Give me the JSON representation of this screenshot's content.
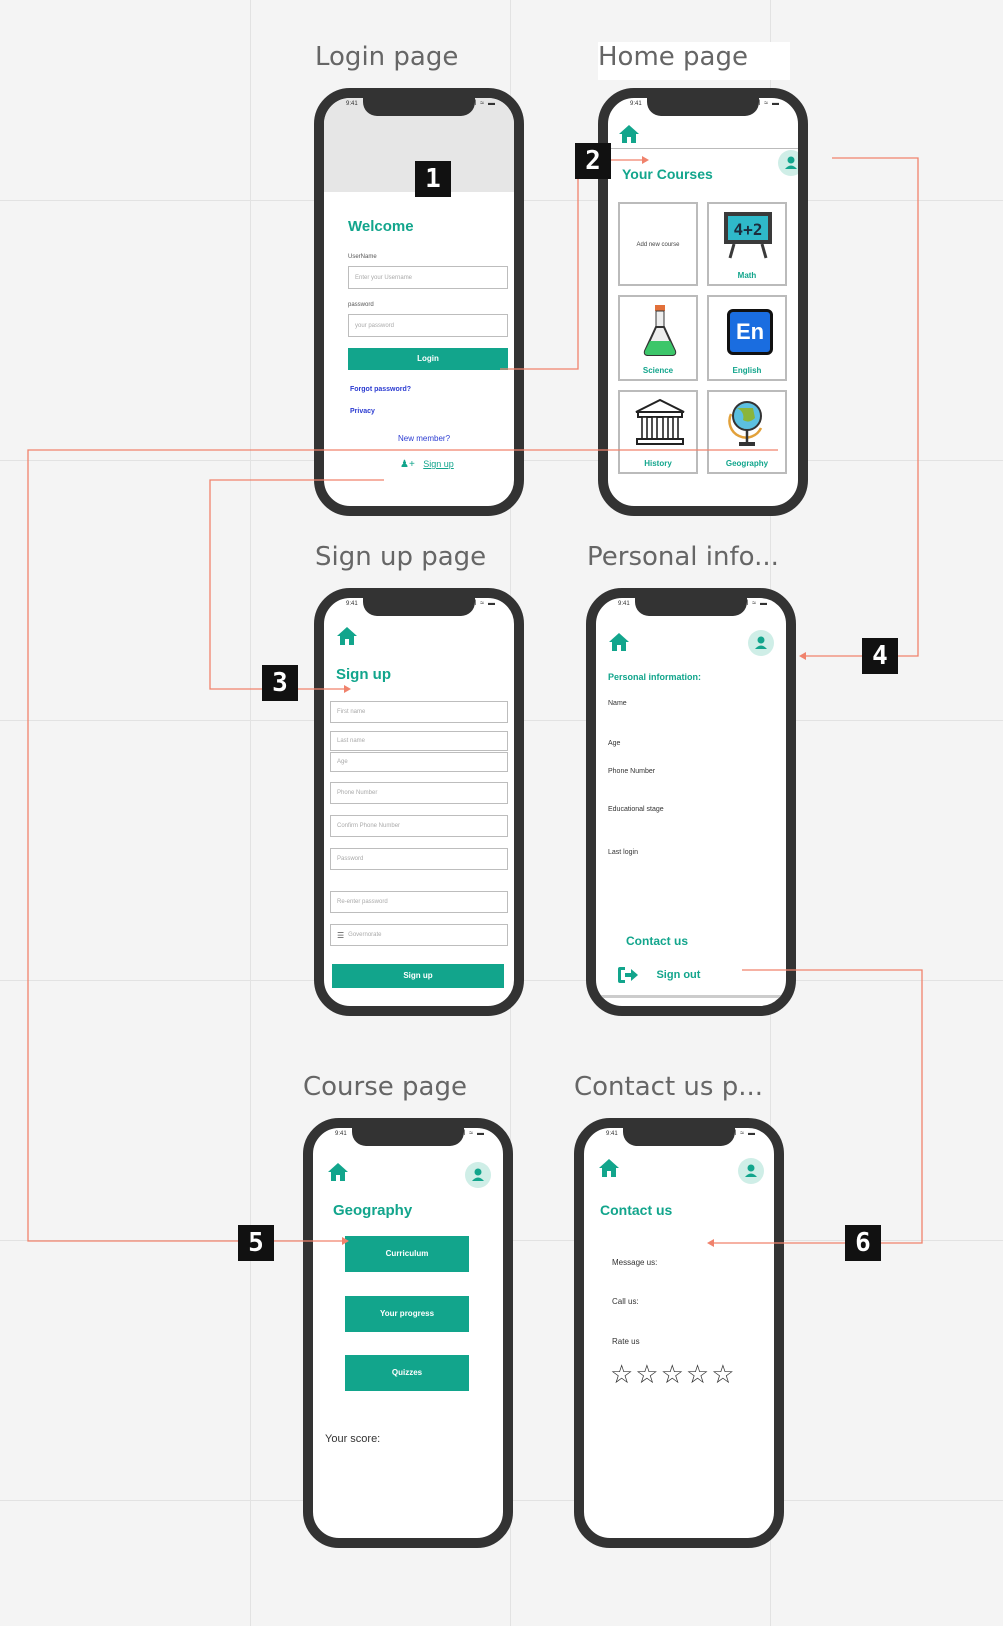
{
  "frames": {
    "login": "Login page",
    "home": "Home page",
    "signup": "Sign up page",
    "personal": "Personal info...",
    "course": "Course page",
    "contact": "Contact us p..."
  },
  "status_bar": {
    "time": "9:41",
    "icons": "ıl ≈ ▬"
  },
  "badges": [
    "1",
    "2",
    "3",
    "4",
    "5",
    "6"
  ],
  "login": {
    "welcome": "Welcome",
    "username_label": "UserName",
    "username_placeholder": "Enter your Username",
    "password_label": "password",
    "password_placeholder": "your password",
    "login_button": "Login",
    "forgot": "Forgot password?",
    "privacy": "Privacy",
    "new_member": "New member?",
    "signup_link": "Sign up"
  },
  "home": {
    "title": "Your Courses",
    "add_courses": "Add new course",
    "courses": [
      "Math",
      "Science",
      "English",
      "History",
      "Geography"
    ],
    "math_board": "4+2",
    "english_badge": "En"
  },
  "signup": {
    "title": "Sign up",
    "fields": [
      "First name",
      "Last name",
      "Age",
      "Phone Number",
      "Confirm Phone Number",
      "Password",
      "Re-enter password",
      "Governorate"
    ],
    "button": "Sign up"
  },
  "personal": {
    "title": "Personal information:",
    "fields": [
      "Name",
      "Age",
      "Phone Number",
      "Educational stage",
      "Last login"
    ],
    "contact_us": "Contact us",
    "sign_out": "Sign out"
  },
  "course": {
    "title": "Geography",
    "buttons": [
      "Curriculum",
      "Your progress",
      "Quizzes"
    ],
    "score": "Your score:"
  },
  "contact": {
    "title": "Contact us",
    "message": "Message us:",
    "call": "Call us:",
    "rate": "Rate us",
    "stars": "☆☆☆☆☆"
  },
  "colors": {
    "accent": "#12a58c",
    "connector": "#f0826c",
    "link": "#2b3bd1",
    "phone_frame": "#333333"
  }
}
